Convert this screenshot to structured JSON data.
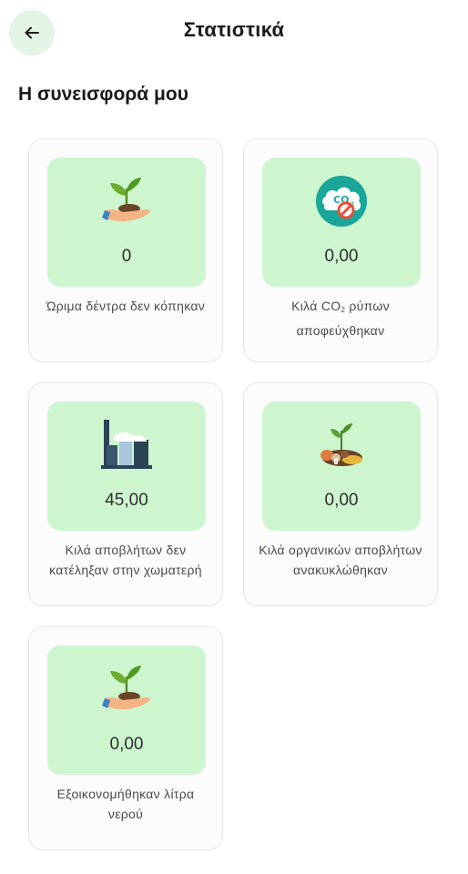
{
  "header": {
    "title": "Στατιστικά",
    "back_icon": "arrow-left-icon"
  },
  "section": {
    "title": "Η συνεισφορά μου"
  },
  "colors": {
    "tile_background": "#cdf6cf",
    "back_button_background": "#e3f5e6",
    "card_border": "#e6e6e6"
  },
  "cards": [
    {
      "icon": "plant-in-hand-icon",
      "value": "0",
      "label": "Ώριμα δέντρα δεν κόπηκαν"
    },
    {
      "icon": "co2-no-emissions-icon",
      "value": "0,00",
      "label_prefix": "Κιλά CO",
      "label_sub": "2",
      "label_suffix": " ρύπων αποφεύχθηκαν"
    },
    {
      "icon": "factory-icon",
      "value": "45,00",
      "label": "Κιλά αποβλήτων δεν κατέληξαν στην χωματερή"
    },
    {
      "icon": "organic-waste-icon",
      "value": "0,00",
      "label": "Κιλά οργανικών αποβλήτων ανακυκλώθηκαν"
    },
    {
      "icon": "plant-in-hand-icon",
      "value": "0,00",
      "label": "Εξοικονομήθηκαν λίτρα νερού"
    }
  ]
}
